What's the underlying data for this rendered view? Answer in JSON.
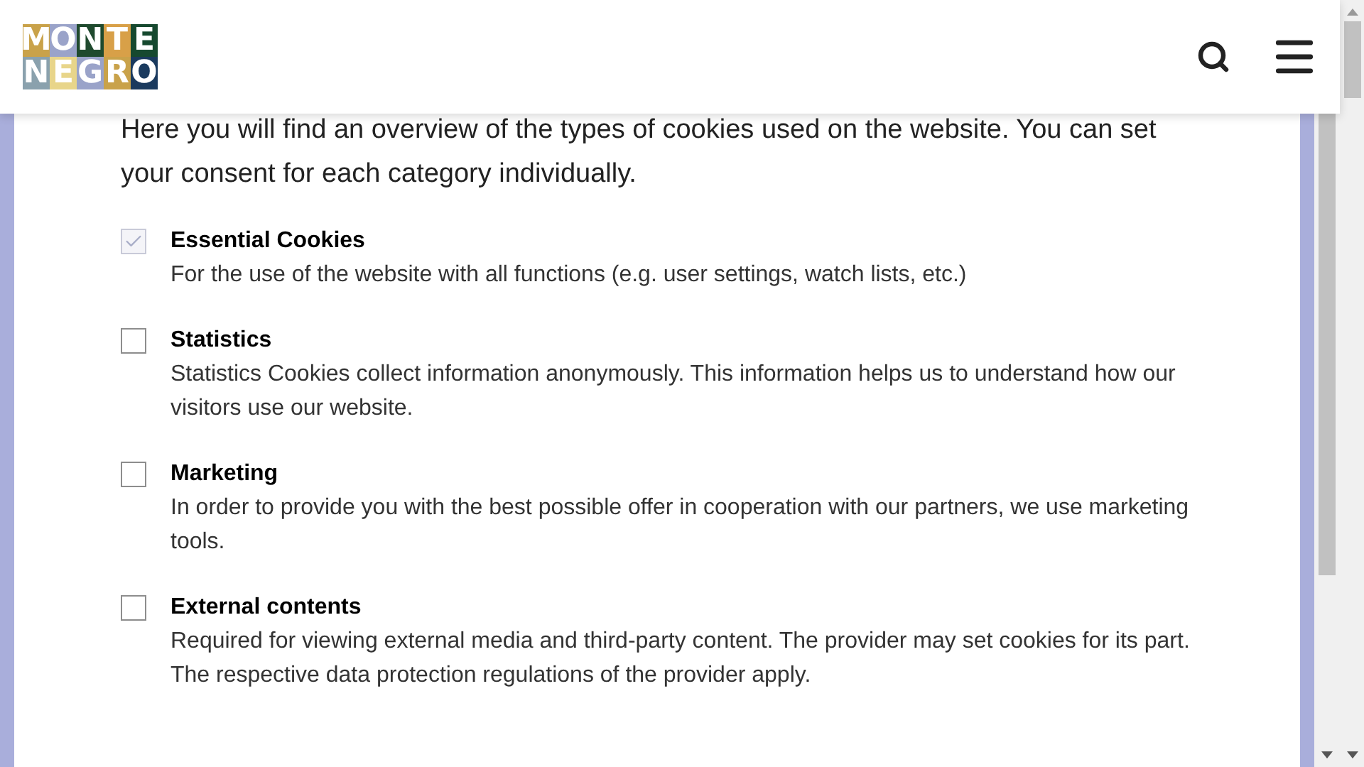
{
  "header": {
    "logo": {
      "lines": [
        "MONTE",
        "NEGRO"
      ]
    }
  },
  "intro": "Here you will find an overview of the types of cookies used on the website. You can set your consent for each category individually.",
  "categories": [
    {
      "title": "Essential Cookies",
      "description": "For the use of the website with all functions (e.g. user settings, watch lists, etc.)",
      "checked": true,
      "disabled": true
    },
    {
      "title": "Statistics",
      "description": "Statistics Cookies collect information anonymously. This information helps us to understand how our visitors use our website.",
      "checked": false,
      "disabled": false
    },
    {
      "title": "Marketing",
      "description": "In order to provide you with the best possible offer in cooperation with our partners, we use marketing tools.",
      "checked": false,
      "disabled": false
    },
    {
      "title": "External contents",
      "description": "Required for viewing external media and third-party content. The provider may set cookies for its part. The respective data protection regulations of the provider apply.",
      "checked": false,
      "disabled": false
    }
  ]
}
